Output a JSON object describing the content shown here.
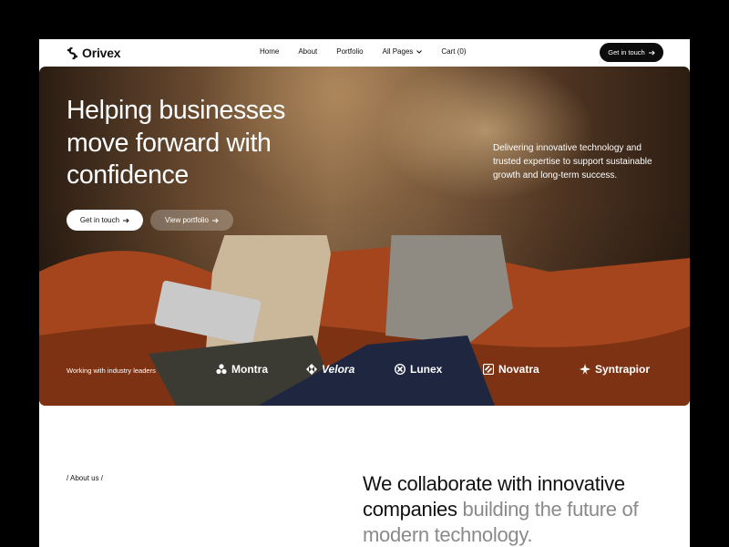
{
  "brand": {
    "name": "Orivex"
  },
  "nav": {
    "items": [
      "Home",
      "About",
      "Portfolio",
      "All Pages",
      "Cart (0)"
    ],
    "cta_label": "Get in touch"
  },
  "hero": {
    "title": "Helping businesses move forward with confidence",
    "description": "Delivering innovative technology and trusted expertise to support sustainable growth and long-term success.",
    "primary_label": "Get in touch",
    "secondary_label": "View portfolio",
    "partners_label": "Working with industry leaders",
    "partners": [
      "Montra",
      "Velora",
      "Lunex",
      "Novatra",
      "Syntrapior"
    ]
  },
  "about": {
    "label": "/ About us /",
    "heading_dark": "We collaborate with innovative companies",
    "heading_muted": "building the future of modern technology."
  },
  "colors": {
    "background": "#000000",
    "page": "#ffffff",
    "dark_button": "#0c0c0c",
    "muted_text": "#8a8a8a"
  }
}
